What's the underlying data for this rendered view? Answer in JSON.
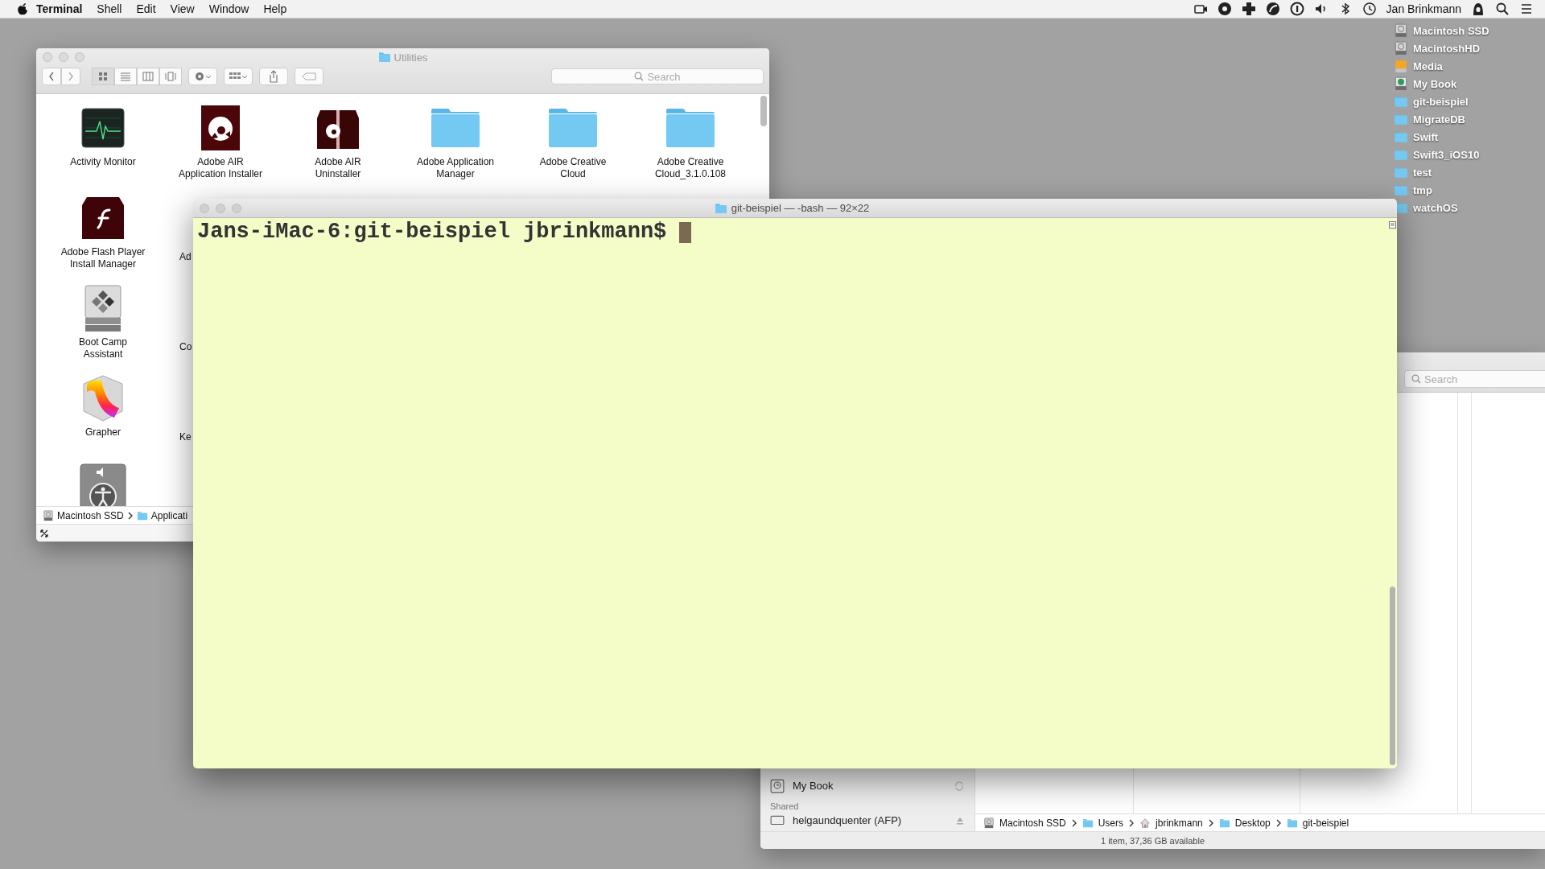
{
  "menu_bar": {
    "app": "Terminal",
    "menus": [
      "Shell",
      "Edit",
      "View",
      "Window",
      "Help"
    ],
    "user": "Jan Brinkmann"
  },
  "desktop_items": [
    {
      "label": "Macintosh SSD",
      "kind": "drive"
    },
    {
      "label": "MacintoshHD",
      "kind": "drive"
    },
    {
      "label": "Media",
      "kind": "removable"
    },
    {
      "label": "My Book",
      "kind": "backup"
    },
    {
      "label": "git-beispiel",
      "kind": "folder"
    },
    {
      "label": "MigrateDB",
      "kind": "folder"
    },
    {
      "label": "Swift",
      "kind": "folder"
    },
    {
      "label": "Swift3_iOS10",
      "kind": "folder"
    },
    {
      "label": "test",
      "kind": "folder"
    },
    {
      "label": "tmp",
      "kind": "folder"
    },
    {
      "label": "watchOS",
      "kind": "folder"
    }
  ],
  "utilities": {
    "title": "Utilities",
    "search_placeholder": "Search",
    "view_buttons": [
      {
        "selected": true
      },
      {
        "selected": false
      },
      {
        "selected": false
      },
      {
        "selected": false
      }
    ],
    "items": [
      {
        "label": "Activity Monitor",
        "kind": "activity"
      },
      {
        "label": "Adobe AIR\nApplication Installer",
        "kind": "air"
      },
      {
        "label": "Adobe AIR\nUninstaller",
        "kind": "uninstaller"
      },
      {
        "label": "Adobe Application\nManager",
        "kind": "folder"
      },
      {
        "label": "Adobe Creative\nCloud",
        "kind": "folder"
      },
      {
        "label": "Adobe Creative\nCloud_3.1.0.108",
        "kind": "folder"
      },
      {
        "label": "Adobe Flash Player\nInstall Manager",
        "kind": "flash"
      },
      {
        "label": "Boot Camp\nAssistant",
        "kind": "bootcamp"
      },
      {
        "label": "Grapher",
        "kind": "grapher"
      },
      {
        "kind": "accessibility"
      }
    ],
    "cut_labels": [
      "Ad",
      "Co",
      "Ke"
    ],
    "path": [
      {
        "label": "Macintosh SSD",
        "kind": "drive"
      },
      {
        "label": "Applicati",
        "kind": "folder"
      }
    ]
  },
  "terminal": {
    "title": "git-beispiel — -bash — 92×22",
    "prompt": "Jans-iMac-6:git-beispiel jbrinkmann$"
  },
  "finder_back": {
    "search_placeholder": "Search",
    "sidebar": [
      {
        "label": "My Book",
        "kind": "device"
      },
      {
        "label": "Shared",
        "kind": "header"
      },
      {
        "label": "helgaundquenter (AFP)",
        "kind": "server"
      }
    ],
    "path": [
      {
        "label": "Macintosh SSD",
        "kind": "drive"
      },
      {
        "label": "Users",
        "kind": "folder"
      },
      {
        "label": "jbrinkmann",
        "kind": "home"
      },
      {
        "label": "Desktop",
        "kind": "folder"
      },
      {
        "label": "git-beispiel",
        "kind": "folder"
      }
    ],
    "status": "1 item, 37,36 GB available"
  }
}
